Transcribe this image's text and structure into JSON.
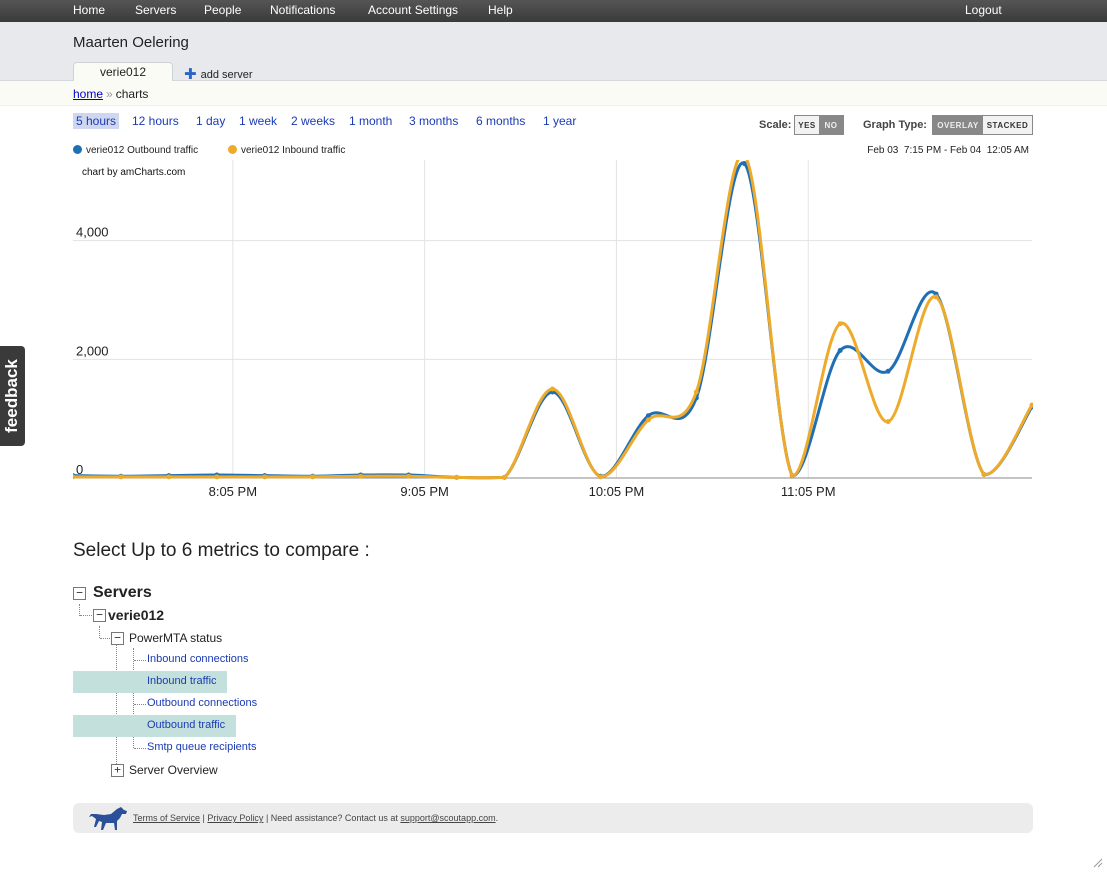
{
  "nav": {
    "items": [
      "Home",
      "Servers",
      "People",
      "Notifications",
      "Account Settings",
      "Help"
    ],
    "logout": "Logout"
  },
  "header": {
    "account_name": "Maarten Oelering",
    "server_tab": "verie012",
    "add_server": "add server"
  },
  "breadcrumb": {
    "home": "home",
    "separator": "»",
    "current": "charts"
  },
  "ranges": {
    "items": [
      "5 hours",
      "12 hours",
      "1 day",
      "1 week",
      "2 weeks",
      "1 month",
      "3 months",
      "6 months",
      "1 year"
    ],
    "active": "5 hours"
  },
  "scale": {
    "label": "Scale:",
    "yes": "YES",
    "no": "NO",
    "selected": "NO"
  },
  "graph_type": {
    "label": "Graph Type:",
    "overlay": "OVERLAY",
    "stacked": "STACKED",
    "selected": "OVERLAY"
  },
  "chart_data": {
    "type": "line",
    "credit": "chart by amCharts.com",
    "date_range": "Feb 03  7:15 PM - Feb 04  12:05 AM",
    "ylim": [
      0,
      6000
    ],
    "y_ticks": [
      "0",
      "2,000",
      "4,000"
    ],
    "y_tick_values": [
      0,
      2000,
      4000
    ],
    "xlim": [
      0,
      300
    ],
    "x_ticks": [
      "8:05 PM",
      "9:05 PM",
      "10:05 PM",
      "11:05 PM"
    ],
    "x_tick_values": [
      50,
      110,
      170,
      230
    ],
    "grid": true,
    "legend": "top-left",
    "series": [
      {
        "name": "verie012 Outbound traffic",
        "color": "#1f6fb5",
        "x": [
          0,
          15,
          30,
          45,
          60,
          75,
          90,
          105,
          120,
          135,
          150,
          165,
          180,
          195,
          210,
          225,
          240,
          255,
          270,
          285,
          300
        ],
        "y": [
          40,
          30,
          40,
          50,
          40,
          30,
          50,
          50,
          10,
          10,
          1450,
          30,
          1050,
          1350,
          5300,
          40,
          2150,
          1800,
          3100,
          60,
          1200
        ]
      },
      {
        "name": "verie012 Inbound traffic",
        "color": "#eeaa2a",
        "x": [
          0,
          15,
          30,
          45,
          60,
          75,
          90,
          105,
          120,
          135,
          150,
          165,
          180,
          195,
          210,
          225,
          240,
          255,
          270,
          285,
          300
        ],
        "y": [
          20,
          20,
          20,
          20,
          20,
          20,
          30,
          30,
          10,
          10,
          1500,
          20,
          980,
          1450,
          5450,
          40,
          2600,
          950,
          3050,
          60,
          1230
        ]
      }
    ]
  },
  "metrics": {
    "title": "Select Up to 6 metrics to compare :",
    "root": "Servers",
    "server": "verie012",
    "group": "PowerMTA status",
    "items": [
      "Inbound connections",
      "Inbound traffic",
      "Outbound connections",
      "Outbound traffic",
      "Smtp queue recipients"
    ],
    "selected": [
      "Inbound traffic",
      "Outbound traffic"
    ],
    "other_group": "Server Overview",
    "collapse_glyph": "−",
    "expand_glyph": "+"
  },
  "footer": {
    "terms": "Terms of Service",
    "privacy": "Privacy Policy",
    "assistance": "Need assistance? Contact us at",
    "email": "support@scoutapp.com",
    "pipe": "|",
    "period": "."
  },
  "feedback": {
    "label": "feedback"
  },
  "colors": {
    "outbound": "#1f6fb5",
    "inbound": "#eeaa2a",
    "link": "#1a3bb3",
    "highlight": "#c3e0dd",
    "nav_bg": "#444444"
  }
}
